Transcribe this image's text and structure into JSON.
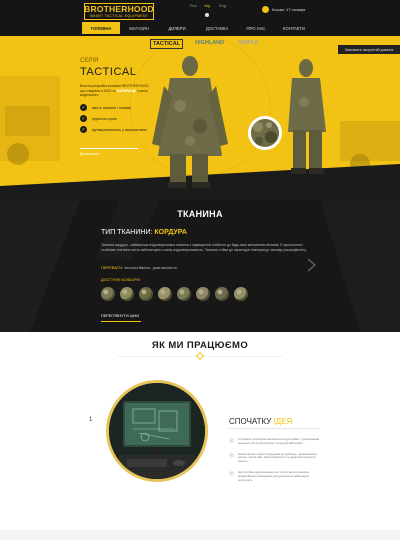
{
  "header": {
    "logo_main": "BROTHERHOOD",
    "logo_sub": "SMART TACTICAL EQUIPMENT",
    "languages": [
      "Рос",
      "Укр",
      "Eng"
    ],
    "active_language": "Укр",
    "cart_text": "Кошик: 17 позиція",
    "nav": [
      "ГОЛОВНА",
      "МАГАЗИН",
      "ДИЛЕРИ",
      "ДОСТАВКА",
      "ПРО НАС",
      "КОНТАКТИ"
    ],
    "active_nav": "ГОЛОВНА"
  },
  "subtabs": [
    "TACTICAL",
    "HIGHLAND",
    "SIMPLE"
  ],
  "callback_label": "Замовити зворотній дзвінок",
  "hero": {
    "series_label": "СЕРІЯ",
    "series_title": "TACTICAL",
    "desc_before": "Власна розробка компанії BROTHERHOOD, що створена в 2013 та ",
    "desc_highlight": "НАЙКРАЩЕ",
    "desc_after": " з свого модельного",
    "features": [
      "якість тканини і пошиву",
      "зручність крою",
      "функціональність у використанні"
    ],
    "link_text": "Детальніше"
  },
  "fabric": {
    "title": "ТКАНИНА",
    "type_label": "ТИП ТКАНИНИ:",
    "type_name": "КОРДУРА",
    "description": "Тканина кордура - найміцніша водонепроникна тканина з підвищеною стійкістю до будь-яких механічних впливів. Її просочення і особливе плетіння ниток забезпечують повну водонепроникність. Тканина стійка до перепадів температур і впливу ультрафіолету.",
    "advantages_label": "ПЕРЕВАГИ:",
    "advantages": " зносостійкість, довговічність",
    "colors_label": "ДОСТУПНІ КОЛЬОРИ:",
    "swatch_colors": [
      "#7c7a52",
      "#8d8a5c",
      "#6d6a44",
      "#9a916a",
      "#7a7d5a",
      "#8f8568",
      "#6f6b4e",
      "#938d68"
    ],
    "prices_button": "ПЕРЕГЛЯНУТИ ЦІНИ"
  },
  "how_we_work": {
    "title": "ЯК МИ ПРАЦЮЄМО",
    "step_number": "1",
    "step_title_prefix": "СПОЧАТКУ ",
    "step_title_highlight": "ІДЕЯ",
    "items": [
      "Усі моделі розроблені нашими конструкторами, з урахуванням реальних умов експлуатації та відгуків військових.",
      "Кожна деталь моделі продумана до дрібниць: функціональні кишені, зручні шви, якісна фурнітура та додаткові елементи захисту.",
      "Ідеї постійно вдосконалюються та тестуються нашими професійними командами для досягнення найкращого результату."
    ]
  },
  "colors": {
    "accent": "#f2c314",
    "dark": "#171717",
    "header": "#151515"
  }
}
